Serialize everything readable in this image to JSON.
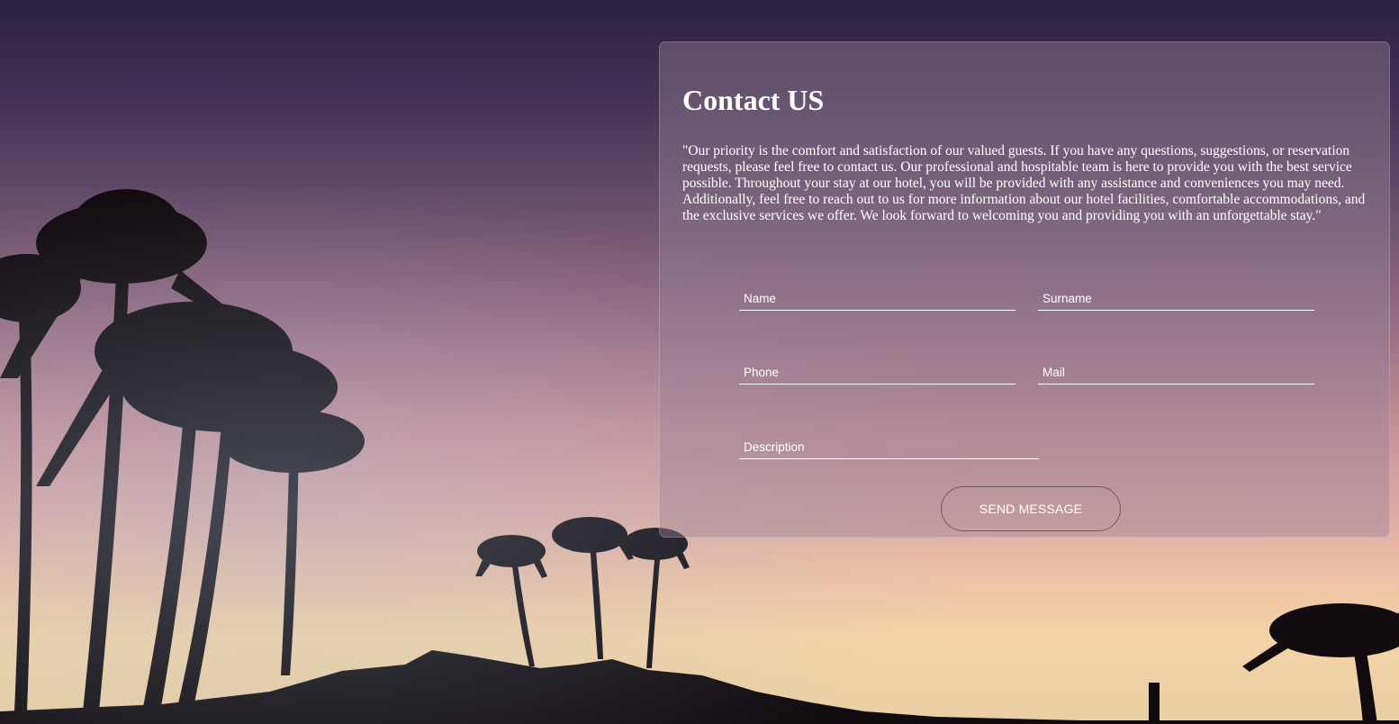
{
  "contact": {
    "title": "Contact US",
    "intro": "\"Our priority is the comfort and satisfaction of our valued guests. If you have any questions, suggestions, or reservation requests, please feel free to contact us. Our professional and hospitable team is here to provide you with the best service possible. Throughout your stay at our hotel, you will be provided with any assistance and conveniences you may need. Additionally, feel free to reach out to us for more information about our hotel facilities, comfortable accommodations, and the exclusive services we offer. We look forward to welcoming you and providing you with an unforgettable stay.\"",
    "form": {
      "name": {
        "placeholder": "Name",
        "value": ""
      },
      "surname": {
        "placeholder": "Surname",
        "value": ""
      },
      "phone": {
        "placeholder": "Phone",
        "value": ""
      },
      "mail": {
        "placeholder": "Mail",
        "value": ""
      },
      "description": {
        "placeholder": "Description",
        "value": ""
      },
      "send_label": "SEND MESSAGE"
    }
  },
  "background": {
    "subject": "sunset-palm-trees-photo",
    "colors": {
      "sky_top": "#2c2140",
      "sky_mid": "#a77a8b",
      "sky_horizon": "#f3d4a6",
      "silhouette": "#120c10"
    }
  },
  "theme": {
    "panel_bg": "rgba(150,130,150,0.42)",
    "text": "#ffffff",
    "button_border": "#6f5a6a"
  }
}
